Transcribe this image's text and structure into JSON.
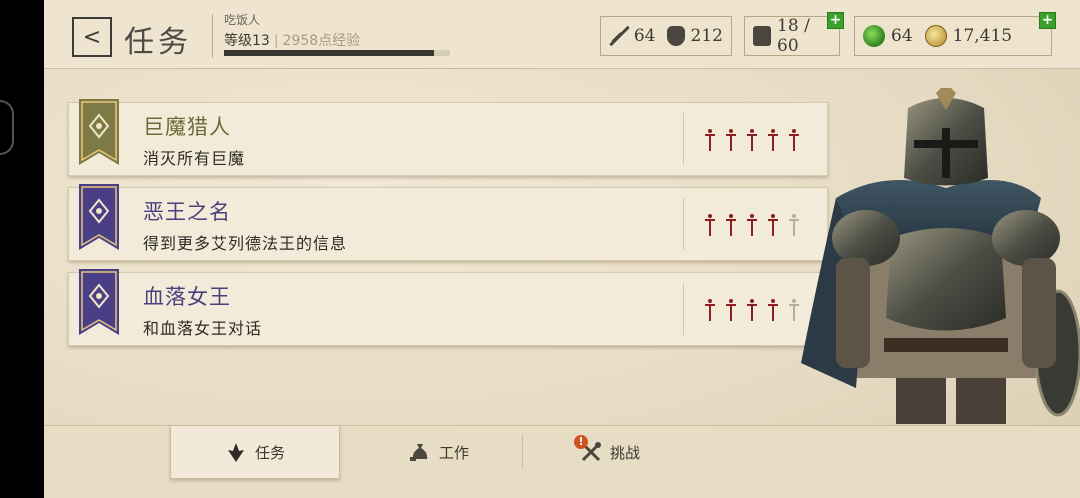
{
  "header": {
    "title": "任务",
    "back_label": "<",
    "player_name": "吃饭人",
    "level_label": "等级13",
    "xp_text": "2958点经验",
    "xp_progress": 0.93,
    "resources": {
      "attack": "64",
      "defense": "212",
      "inventory": "18 / 60",
      "gems": "64",
      "gold": "17,415"
    }
  },
  "quests": [
    {
      "title": "巨魔猎人",
      "desc": "消灭所有巨魔",
      "difficulty": 5,
      "max": 5,
      "banner": "olive"
    },
    {
      "title": "恶王之名",
      "desc": "得到更多艾列德法王的信息",
      "difficulty": 4,
      "max": 5,
      "banner": "purple"
    },
    {
      "title": "血落女王",
      "desc": "和血落女王对话",
      "difficulty": 4,
      "max": 5,
      "banner": "purple"
    }
  ],
  "tabs": {
    "quests": "任务",
    "work": "工作",
    "challenge": "挑战",
    "challenge_badge": "!"
  },
  "colors": {
    "accent_green": "#3aa22a",
    "difficulty_red": "#8c1f1f",
    "olive_banner": "#7d7a45",
    "purple_banner": "#4a3f86"
  }
}
